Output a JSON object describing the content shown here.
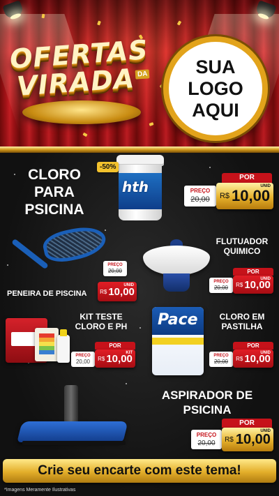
{
  "header": {
    "title_line1": "OFERTAS",
    "title_line2": "VIRADA",
    "title_sup": "DA",
    "logo_line1": "SUA",
    "logo_line2": "LOGO",
    "logo_line3": "AQUI"
  },
  "products": [
    {
      "name": "CLORO PARA PSICINA",
      "name_lines": [
        "CLORO",
        "PARA",
        "PSICINA"
      ],
      "badge": "-50%",
      "brand": "hth",
      "por": "POR",
      "preco_label": "PREÇO",
      "old_price": "20,00",
      "currency": "R$",
      "new_price": "10,00",
      "unit": "UNID"
    },
    {
      "name": "PENEIRA DE PISCINA",
      "preco_label": "PREÇO",
      "old_price": "20,00",
      "currency": "R$",
      "new_price": "10,00",
      "unit": "UNID"
    },
    {
      "name": "FLUTUADOR QUIMICO",
      "name_lines": [
        "FLUTUADOR",
        "QUIMICO"
      ],
      "por": "POR",
      "preco_label": "PREÇO",
      "old_price": "20,00",
      "currency": "R$",
      "new_price": "10,00",
      "unit": "UNID"
    },
    {
      "name": "KIT TESTE CLORO E PH",
      "name_lines": [
        "KIT TESTE",
        "CLORO E PH"
      ],
      "por": "POR",
      "preco_label": "PREÇO",
      "old_price": "20,00",
      "currency": "R$",
      "new_price": "10,00",
      "unit": "KIT"
    },
    {
      "name": "CLORO EM PASTILHA",
      "name_lines": [
        "CLORO EM",
        "PASTILHA"
      ],
      "brand": "Pace",
      "por": "POR",
      "preco_label": "PREÇO",
      "old_price": "20,00",
      "currency": "R$",
      "new_price": "10,00",
      "unit": "UNID"
    },
    {
      "name": "ASPIRADOR DE PSICINA",
      "name_lines": [
        "ASPIRADOR DE",
        "PSICINA"
      ],
      "por": "POR",
      "preco_label": "PREÇO",
      "old_price": "20,00",
      "currency": "R$",
      "new_price": "10,00",
      "unit": "UNID"
    }
  ],
  "cta": "Crie seu encarte com este tema!",
  "disclaimer": "*Imagens Meramente Ilustrativas",
  "colors": {
    "curtain_red": "#b3151a",
    "gold": "#e3ae2a",
    "price_red": "#c6121a",
    "background": "#111111"
  }
}
